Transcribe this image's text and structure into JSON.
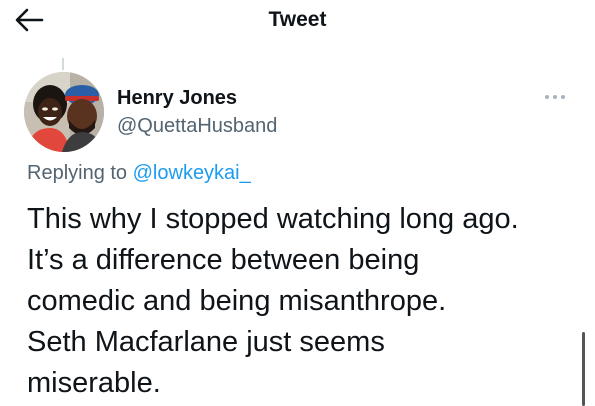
{
  "header": {
    "title": "Tweet",
    "back_icon": "arrow-left-icon"
  },
  "tweet": {
    "author": {
      "display_name": "Henry Jones",
      "username": "@QuettaHusband",
      "avatar": "profile-photo"
    },
    "more_icon": "more-horizontal-icon",
    "replying_to": {
      "prefix": "Replying to",
      "handle": "@lowkeykai_"
    },
    "text_lines": [
      "This why I stopped watching long ago.",
      "It’s a difference between being",
      "comedic and being misanthrope.",
      "Seth Macfarlane just seems",
      "miserable."
    ]
  },
  "colors": {
    "text": "#0f1419",
    "secondary": "#536471",
    "link": "#1d9bf0",
    "thread_line": "#cfd9de"
  }
}
